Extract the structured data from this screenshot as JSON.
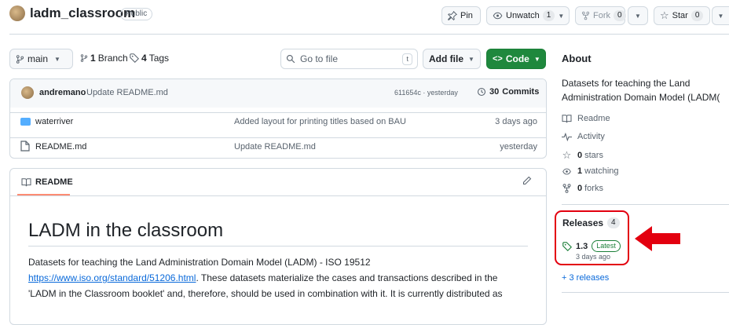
{
  "repo": {
    "name": "ladm_classroom",
    "visibility": "Public"
  },
  "header_actions": {
    "pin": "Pin",
    "unwatch": "Unwatch",
    "unwatch_count": "1",
    "fork": "Fork",
    "fork_count": "0",
    "star": "Star",
    "star_count": "0"
  },
  "toolbar": {
    "branch": "main",
    "branches_count": "1",
    "branches_label": "Branch",
    "tags_count": "4",
    "tags_label": "Tags",
    "goto_placeholder": "Go to file",
    "goto_shortcut": "t",
    "add_file": "Add file",
    "code": "Code"
  },
  "commit": {
    "author": "andremano",
    "message": "Update README.md",
    "hash_time": "611654c · yesterday",
    "commits_count": "30",
    "commits_label": "Commits"
  },
  "files": [
    {
      "name": "waterriver",
      "type": "folder",
      "message": "Added layout for printing titles based on BAU",
      "time": "3 days ago"
    },
    {
      "name": "README.md",
      "type": "file",
      "message": "Update README.md",
      "time": "yesterday"
    }
  ],
  "readme": {
    "tab": "README",
    "heading": "LADM in the classroom",
    "line1": "Datasets for teaching the Land Administration Domain Model (LADM) - ISO 19512",
    "link": "https://www.iso.org/standard/51206.html",
    "line2_rest": ". These datasets materialize the cases and transactions described in the",
    "line3": "'LADM in the Classroom booklet' and, therefore, should be used in combination with it. It is currently distributed as"
  },
  "about": {
    "title": "About",
    "desc_line1": "Datasets for teaching the Land",
    "desc_line2": "Administration Domain Model (LADM(",
    "readme": "Readme",
    "activity": "Activity",
    "stars_count": "0",
    "stars_label": "stars",
    "watching_count": "1",
    "watching_label": "watching",
    "forks_count": "0",
    "forks_label": "forks"
  },
  "releases": {
    "title": "Releases",
    "count": "4",
    "version": "1.3",
    "latest": "Latest",
    "time": "3 days ago",
    "more": "+ 3 releases"
  },
  "colors": {
    "accent_green": "#1f883d",
    "link_blue": "#0969da",
    "highlight_red": "#e3000f",
    "folder_blue": "#54aeff"
  },
  "icons": [
    "repo-avatar",
    "pin-icon",
    "eye-icon",
    "fork-icon",
    "star-icon",
    "branch-icon",
    "tag-icon",
    "search-icon",
    "code-icon",
    "history-icon",
    "folder-icon",
    "file-icon",
    "book-icon",
    "pencil-icon",
    "pulse-icon",
    "arrow-icon"
  ]
}
